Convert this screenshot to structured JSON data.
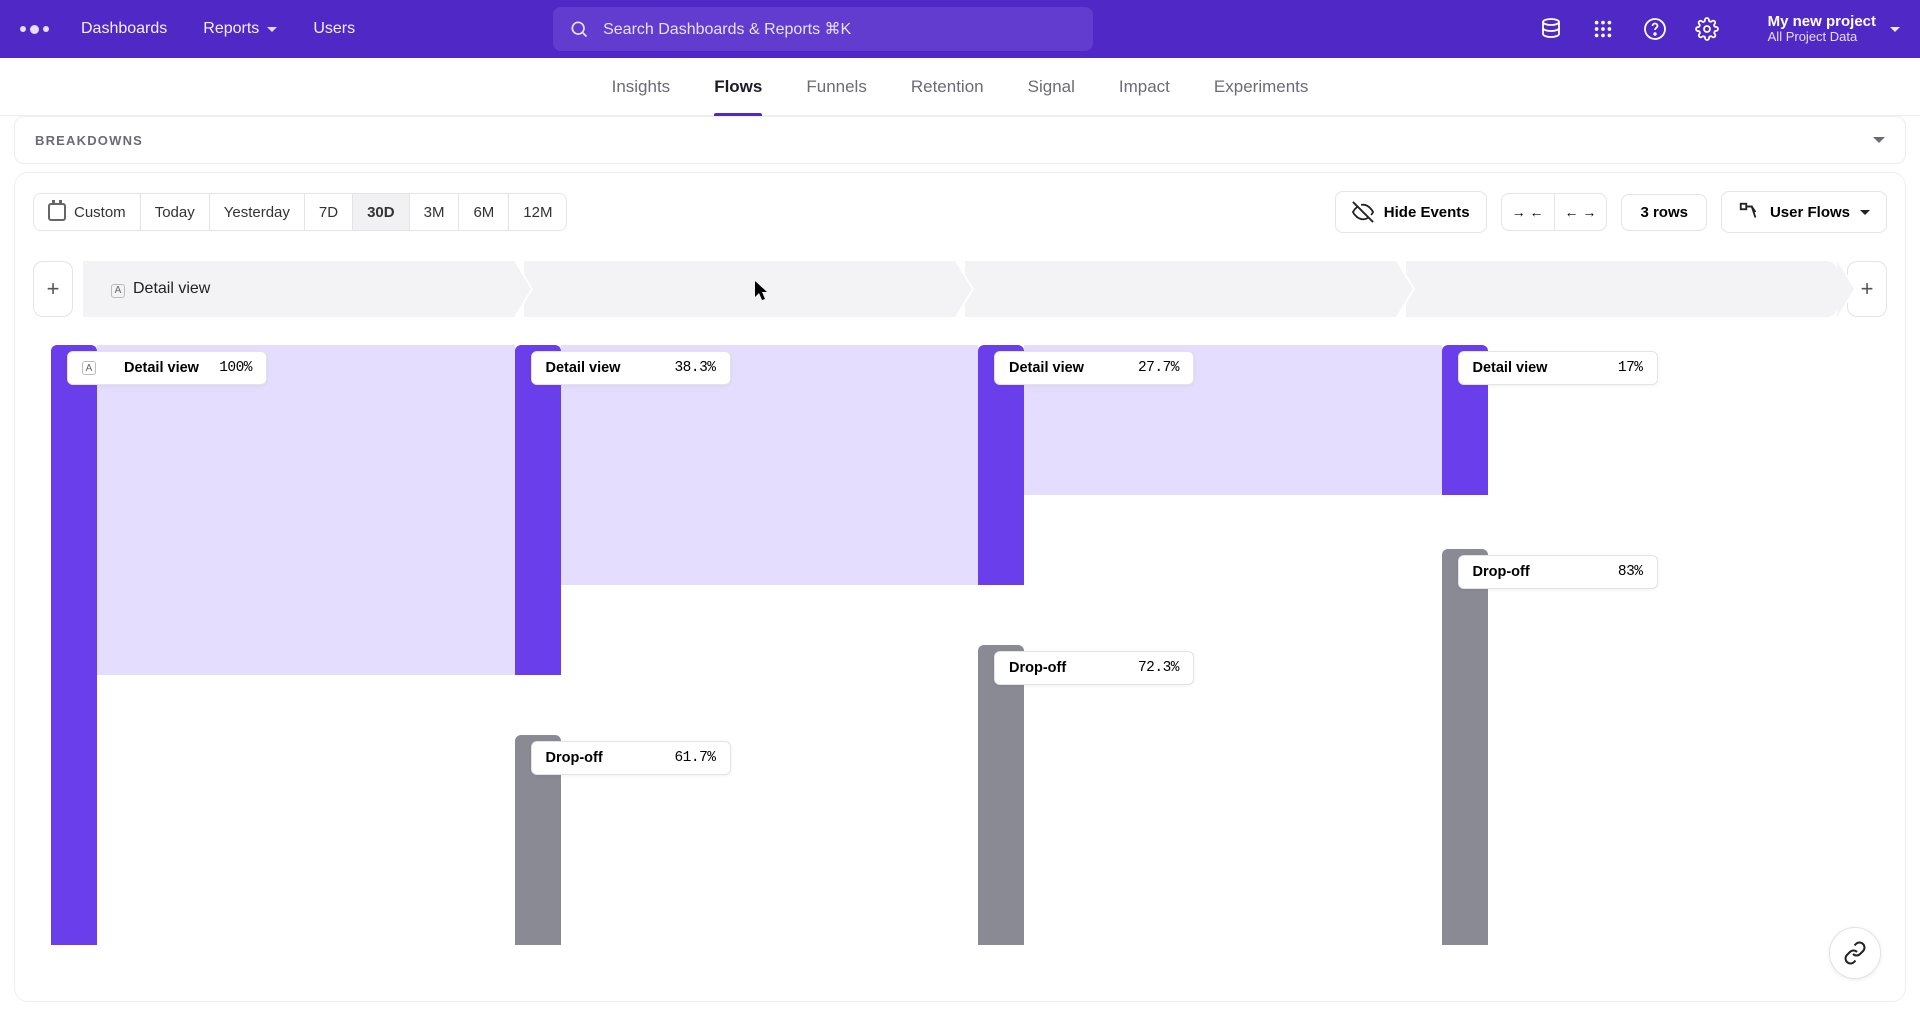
{
  "topnav": {
    "dashboards": "Dashboards",
    "reports": "Reports",
    "users": "Users"
  },
  "search": {
    "placeholder": "Search Dashboards & Reports ⌘K"
  },
  "project": {
    "name": "My new project",
    "sub": "All Project Data"
  },
  "tabs": [
    "Insights",
    "Flows",
    "Funnels",
    "Retention",
    "Signal",
    "Impact",
    "Experiments"
  ],
  "tabs_active_index": 1,
  "breakdowns_label": "BREAKDOWNS",
  "dateranges": [
    "Custom",
    "Today",
    "Yesterday",
    "7D",
    "30D",
    "3M",
    "6M",
    "12M"
  ],
  "daterange_active_index": 4,
  "controls": {
    "hide_events": "Hide Events",
    "rows": "3 rows",
    "mode": "User Flows"
  },
  "step": {
    "tag": "A",
    "label": "Detail view"
  },
  "chart_data": {
    "type": "sankey-flow",
    "columns": [
      {
        "detail": {
          "label": "Detail view",
          "pct": "100%",
          "height_pct": 100
        },
        "tag": "A"
      },
      {
        "detail": {
          "label": "Detail view",
          "pct": "38.3%",
          "height_pct": 55
        },
        "dropoff": {
          "label": "Drop-off",
          "pct": "61.7%",
          "top_pct": 65,
          "height_pct": 35
        }
      },
      {
        "detail": {
          "label": "Detail view",
          "pct": "27.7%",
          "height_pct": 40
        },
        "dropoff": {
          "label": "Drop-off",
          "pct": "72.3%",
          "top_pct": 50,
          "height_pct": 50
        }
      },
      {
        "detail": {
          "label": "Detail view",
          "pct": "17%",
          "height_pct": 25
        },
        "dropoff": {
          "label": "Drop-off",
          "pct": "83%",
          "top_pct": 34,
          "height_pct": 66
        }
      }
    ]
  }
}
